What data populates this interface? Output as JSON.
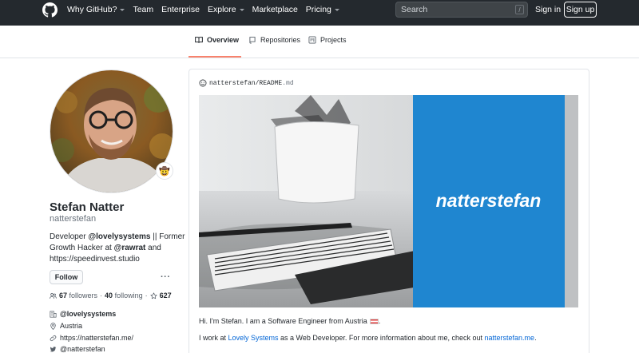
{
  "header": {
    "nav": [
      {
        "label": "Why GitHub?",
        "dropdown": true
      },
      {
        "label": "Team",
        "dropdown": false
      },
      {
        "label": "Enterprise",
        "dropdown": false
      },
      {
        "label": "Explore",
        "dropdown": true
      },
      {
        "label": "Marketplace",
        "dropdown": false
      },
      {
        "label": "Pricing",
        "dropdown": true
      }
    ],
    "search_placeholder": "Search",
    "search_shortcut": "/",
    "signin_label": "Sign in",
    "signup_label": "Sign up"
  },
  "tabs": [
    {
      "label": "Overview",
      "icon": "book-icon",
      "active": true
    },
    {
      "label": "Repositories",
      "icon": "repo-icon",
      "active": false
    },
    {
      "label": "Projects",
      "icon": "project-icon",
      "active": false
    }
  ],
  "profile": {
    "status_emoji": "🤠",
    "name": "Stefan Natter",
    "username": "natterstefan",
    "bio": {
      "prefix": "Developer ",
      "org1": "@lovelysystems",
      "middle": " || Former Growth Hacker at ",
      "org2": "@rawrat",
      "suffix": " and https://speedinvest.studio"
    },
    "follow_label": "Follow",
    "more_label": "···",
    "followers_count": "67",
    "followers_label": "followers",
    "following_count": "40",
    "following_label": "following",
    "stars_count": "627",
    "company": "@lovelysystems",
    "location": "Austria",
    "website": "https://natterstefan.me/",
    "twitter": "@natterstefan"
  },
  "readme": {
    "owner": "natterstefan",
    "separator": "/",
    "file": "README",
    "ext": ".md",
    "banner_text": "natterstefan",
    "intro": "Hi. I'm Stefan. I am a Software Engineer from Austria",
    "line2_prefix": "I work at ",
    "line2_link1": "Lovely Systems",
    "line2_middle": " as a Web Developer. For more information about me, check out ",
    "line2_link2": "natterstefan.me",
    "line2_suffix": "."
  },
  "colors": {
    "header_bg": "#24292e",
    "tab_active_underline": "#f9826c",
    "link": "#0366d6",
    "banner_blue": "#1f86d0"
  }
}
